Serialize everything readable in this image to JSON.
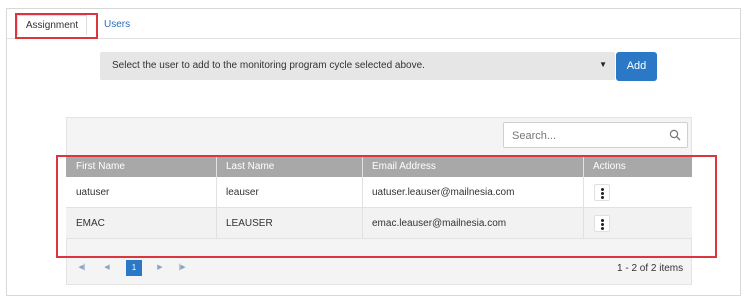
{
  "tabs": [
    {
      "label": "Assignment",
      "active": true
    },
    {
      "label": "Users",
      "active": false
    }
  ],
  "user_select": {
    "value": "Select the user to add to the monitoring program cycle selected above."
  },
  "add_button": {
    "label": "Add"
  },
  "search": {
    "placeholder": "Search..."
  },
  "table": {
    "columns": [
      "First Name",
      "Last Name",
      "Email Address",
      "Actions"
    ],
    "rows": [
      {
        "first": "uatuser",
        "last": "leauser",
        "email": "uatuser.leauser@mailnesia.com"
      },
      {
        "first": "EMAC",
        "last": "LEAUSER",
        "email": "emac.leauser@mailnesia.com"
      }
    ]
  },
  "pager": {
    "current_page": "1",
    "summary": "1 - 2 of 2 items"
  },
  "colors": {
    "accent": "#2b78c6",
    "highlight": "#d9363e",
    "header": "#a8a8a8"
  }
}
